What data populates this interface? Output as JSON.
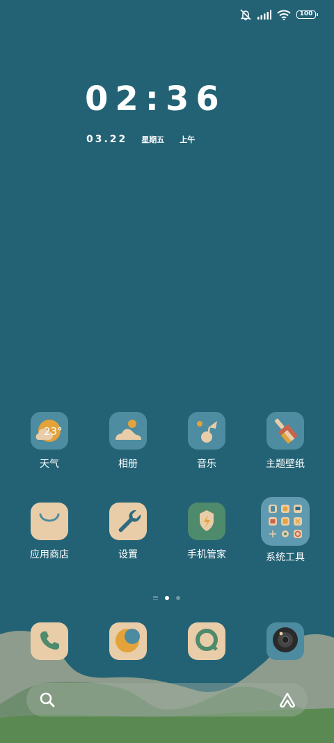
{
  "status_bar": {
    "icons": [
      "mute-bell-icon",
      "signal-icon",
      "wifi-icon",
      "battery-icon"
    ],
    "battery_level": "100"
  },
  "clock": {
    "time": "02:36",
    "date": "03.22",
    "weekday": "星期五",
    "ampm": "上午"
  },
  "apps": [
    {
      "label": "天气",
      "icon": "weather-icon",
      "temp": "23°"
    },
    {
      "label": "相册",
      "icon": "gallery-icon"
    },
    {
      "label": "音乐",
      "icon": "music-icon"
    },
    {
      "label": "主题壁纸",
      "icon": "theme-brush-icon"
    },
    {
      "label": "应用商店",
      "icon": "app-store-bag-icon"
    },
    {
      "label": "设置",
      "icon": "wrench-settings-icon"
    },
    {
      "label": "手机管家",
      "icon": "security-shield-icon"
    },
    {
      "label": "系统工具",
      "icon": "folder-icon"
    }
  ],
  "page_indicator": {
    "pages": 2,
    "active": 1
  },
  "dock": [
    {
      "icon": "phone-icon"
    },
    {
      "icon": "browser-moon-icon"
    },
    {
      "icon": "messages-icon"
    },
    {
      "icon": "camera-icon"
    }
  ],
  "search": {
    "icons": [
      "search-icon",
      "assistant-icon"
    ]
  },
  "colors": {
    "background": "#236275",
    "icon_beige": "#e9cda8",
    "icon_teal": "#4c8ba0",
    "accent_orange": "#e3a33a",
    "accent_green": "#4e8a6c"
  }
}
